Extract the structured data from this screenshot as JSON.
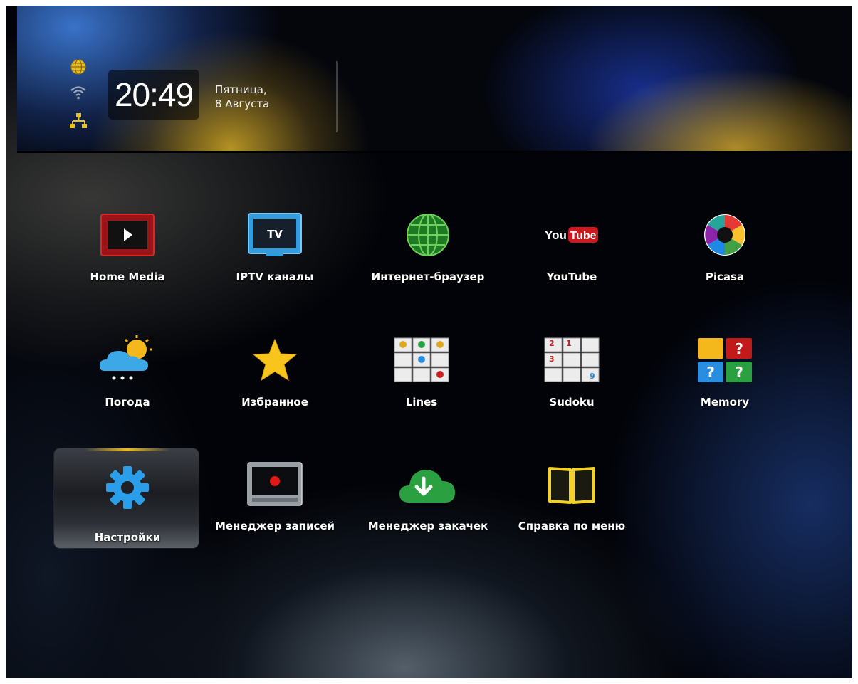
{
  "header": {
    "time": "20:49",
    "day": "Пятница,",
    "date": "8 Августа",
    "status_icons": [
      "globe-icon",
      "wifi-icon",
      "network-icon"
    ]
  },
  "menu": {
    "selected": "Настройки",
    "items": [
      {
        "label": "Home Media",
        "icon": "home-media-icon"
      },
      {
        "label": "IPTV каналы",
        "icon": "tv-icon"
      },
      {
        "label": "Интернет-браузер",
        "icon": "globe-icon"
      },
      {
        "label": "YouTube",
        "icon": "youtube-icon"
      },
      {
        "label": "Picasa",
        "icon": "picasa-icon"
      },
      {
        "label": "Погода",
        "icon": "weather-icon"
      },
      {
        "label": "Избранное",
        "icon": "star-icon"
      },
      {
        "label": "Lines",
        "icon": "lines-game-icon"
      },
      {
        "label": "Sudoku",
        "icon": "sudoku-icon"
      },
      {
        "label": "Memory",
        "icon": "memory-game-icon"
      },
      {
        "label": "Настройки",
        "icon": "gear-icon"
      },
      {
        "label": "Менеджер записей",
        "icon": "record-icon"
      },
      {
        "label": "Менеджер закачек",
        "icon": "download-icon"
      },
      {
        "label": "Справка по меню",
        "icon": "book-icon"
      }
    ],
    "youtube_logo": {
      "you": "You",
      "tube": "Tube"
    },
    "tv_icon_text": "TV",
    "sudoku_digits": [
      "2",
      "1",
      "3",
      "9"
    ]
  },
  "colors": {
    "accent_selected": "#ffc828",
    "youtube_red": "#cc181e",
    "tv_blue": "#2f9ee0"
  }
}
